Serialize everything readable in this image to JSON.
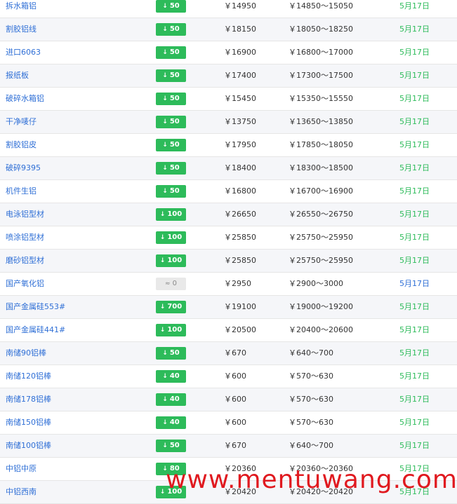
{
  "colors": {
    "name": "#2f6fd6",
    "down_badge": "#2dbb5a",
    "flat_badge": "#e9e9e9",
    "date_green": "#2dbb5a",
    "date_blue": "#2f6fd6",
    "watermark": "#e0191f"
  },
  "rows": [
    {
      "name": "拆水箱铝",
      "trend": "down",
      "change": "50",
      "price": "￥14950",
      "range": "￥14850～15050",
      "date": "5月17日"
    },
    {
      "name": "割胶铝线",
      "trend": "down",
      "change": "50",
      "price": "￥18150",
      "range": "￥18050～18250",
      "date": "5月17日"
    },
    {
      "name": "进口6063",
      "trend": "down",
      "change": "50",
      "price": "￥16900",
      "range": "￥16800～17000",
      "date": "5月17日"
    },
    {
      "name": "报纸板",
      "trend": "down",
      "change": "50",
      "price": "￥17400",
      "range": "￥17300～17500",
      "date": "5月17日"
    },
    {
      "name": "破碎水箱铝",
      "trend": "down",
      "change": "50",
      "price": "￥15450",
      "range": "￥15350～15550",
      "date": "5月17日"
    },
    {
      "name": "干净唛仔",
      "trend": "down",
      "change": "50",
      "price": "￥13750",
      "range": "￥13650～13850",
      "date": "5月17日"
    },
    {
      "name": "割胶铝皮",
      "trend": "down",
      "change": "50",
      "price": "￥17950",
      "range": "￥17850～18050",
      "date": "5月17日"
    },
    {
      "name": "破碎9395",
      "trend": "down",
      "change": "50",
      "price": "￥18400",
      "range": "￥18300～18500",
      "date": "5月17日"
    },
    {
      "name": "机件生铝",
      "trend": "down",
      "change": "50",
      "price": "￥16800",
      "range": "￥16700～16900",
      "date": "5月17日"
    },
    {
      "name": "电泳铝型材",
      "trend": "down",
      "change": "100",
      "price": "￥26650",
      "range": "￥26550～26750",
      "date": "5月17日"
    },
    {
      "name": "喷涂铝型材",
      "trend": "down",
      "change": "100",
      "price": "￥25850",
      "range": "￥25750～25950",
      "date": "5月17日"
    },
    {
      "name": "磨砂铝型材",
      "trend": "down",
      "change": "100",
      "price": "￥25850",
      "range": "￥25750～25950",
      "date": "5月17日"
    },
    {
      "name": "国产氧化铝",
      "trend": "flat",
      "change": "0",
      "price": "￥2950",
      "range": "￥2900～3000",
      "date": "5月17日",
      "date_color": "blue"
    },
    {
      "name": "国产金属硅553#",
      "trend": "down",
      "change": "700",
      "price": "￥19100",
      "range": "￥19000～19200",
      "date": "5月17日"
    },
    {
      "name": "国产金属硅441#",
      "trend": "down",
      "change": "100",
      "price": "￥20500",
      "range": "￥20400～20600",
      "date": "5月17日"
    },
    {
      "name": "南储90铝棒",
      "trend": "down",
      "change": "50",
      "price": "￥670",
      "range": "￥640～700",
      "date": "5月17日"
    },
    {
      "name": "南储120铝棒",
      "trend": "down",
      "change": "40",
      "price": "￥600",
      "range": "￥570～630",
      "date": "5月17日"
    },
    {
      "name": "南储178铝棒",
      "trend": "down",
      "change": "40",
      "price": "￥600",
      "range": "￥570～630",
      "date": "5月17日"
    },
    {
      "name": "南储150铝棒",
      "trend": "down",
      "change": "40",
      "price": "￥600",
      "range": "￥570～630",
      "date": "5月17日"
    },
    {
      "name": "南储100铝棒",
      "trend": "down",
      "change": "50",
      "price": "￥670",
      "range": "￥640～700",
      "date": "5月17日"
    },
    {
      "name": "中铝中原",
      "trend": "down",
      "change": "80",
      "price": "￥20360",
      "range": "￥20360～20360",
      "date": "5月17日"
    },
    {
      "name": "中铝西南",
      "trend": "down",
      "change": "100",
      "price": "￥20420",
      "range": "￥20420～20420",
      "date": "5月17日"
    }
  ],
  "icons": {
    "down": "↓",
    "flat": "≈"
  },
  "watermark_text": "www.mentuwang.com"
}
